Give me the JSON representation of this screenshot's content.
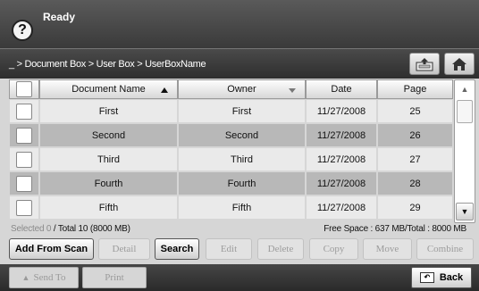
{
  "header": {
    "status": "Ready"
  },
  "breadcrumb": "_ > Document Box > User Box > UserBoxName",
  "icons": {
    "help": "help-icon",
    "upload": "upload-tray-icon",
    "home": "home-icon",
    "back": "back-icon"
  },
  "table": {
    "headers": [
      "Document Name",
      "Owner",
      "Date",
      "Page"
    ],
    "rows": [
      {
        "name": "First",
        "owner": "First",
        "date": "11/27/2008",
        "page": "25"
      },
      {
        "name": "Second",
        "owner": "Second",
        "date": "11/27/2008",
        "page": "26"
      },
      {
        "name": "Third",
        "owner": "Third",
        "date": "11/27/2008",
        "page": "27"
      },
      {
        "name": "Fourth",
        "owner": "Fourth",
        "date": "11/27/2008",
        "page": "28"
      },
      {
        "name": "Fifth",
        "owner": "Fifth",
        "date": "11/27/2008",
        "page": "29"
      }
    ]
  },
  "info": {
    "selected": "Selected 0",
    "total": "/ Total 10 (8000 MB)",
    "free_space": "Free Space : 637 MB/Total : 8000 MB"
  },
  "actions": {
    "add_from_scan": "Add From Scan",
    "detail": "Detail",
    "search": "Search",
    "edit": "Edit",
    "delete": "Delete",
    "copy": "Copy",
    "move": "Move",
    "combine": "Combine"
  },
  "footer": {
    "send_to": "Send To",
    "print": "Print",
    "back": "Back"
  }
}
